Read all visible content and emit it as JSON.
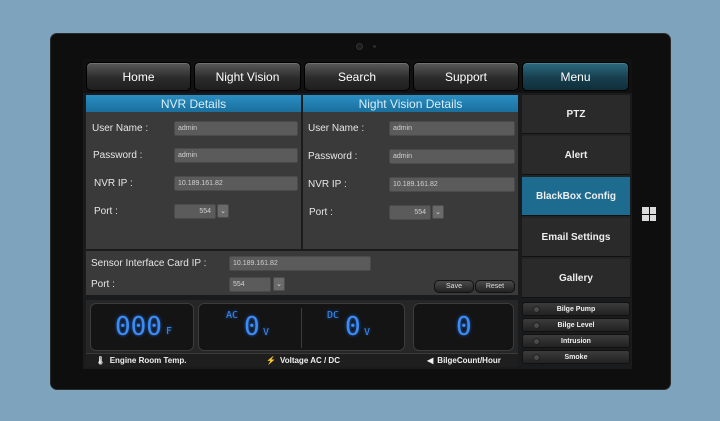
{
  "nav": {
    "items": [
      {
        "label": "Home"
      },
      {
        "label": "Night Vision"
      },
      {
        "label": "Search"
      },
      {
        "label": "Support"
      },
      {
        "label": "Menu"
      }
    ]
  },
  "nvr": {
    "title": "NVR Details",
    "username_label": "User Name :",
    "username_value": "admin",
    "password_label": "Password :",
    "password_value": "admin",
    "ip_label": "NVR IP :",
    "ip_value": "10.189.161.82",
    "port_label": "Port :",
    "port_value": "554"
  },
  "night_vision": {
    "title": "Night Vision Details",
    "username_label": "User Name :",
    "username_value": "admin",
    "password_label": "Password :",
    "password_value": "admin",
    "ip_label": "NVR IP :",
    "ip_value": "10.189.161.82",
    "port_label": "Port :",
    "port_value": "554"
  },
  "sensor": {
    "ip_label": "Sensor Interface Card IP :",
    "ip_value": "10.189.161.82",
    "port_label": "Port :",
    "port_value": "554",
    "save_label": "Save",
    "reset_label": "Reset"
  },
  "side_menu": {
    "items": [
      {
        "label": "PTZ"
      },
      {
        "label": "Alert"
      },
      {
        "label": "BlackBox Config"
      },
      {
        "label": "Email Settings"
      },
      {
        "label": "Gallery"
      }
    ],
    "active_color": "#1d6b8f"
  },
  "gauges": {
    "engine_temp_value": "000",
    "engine_temp_unit": "F",
    "ac_label": "AC",
    "ac_value": "0",
    "ac_unit": "V",
    "dc_label": "DC",
    "dc_value": "0",
    "dc_unit": "V",
    "bilge_count_value": "0",
    "engine_caption": "Engine Room Temp.",
    "voltage_caption": "Voltage AC / DC",
    "bilge_caption": "BilgeCount/Hour",
    "digit_color": "#3d8cf5"
  },
  "status": {
    "items": [
      {
        "label": "Bilge Pump"
      },
      {
        "label": "Bilge Level"
      },
      {
        "label": "Intrusion"
      },
      {
        "label": "Smoke"
      }
    ]
  },
  "colors": {
    "header_blue": "#1a6f9d",
    "background": "#7ea3bd"
  }
}
